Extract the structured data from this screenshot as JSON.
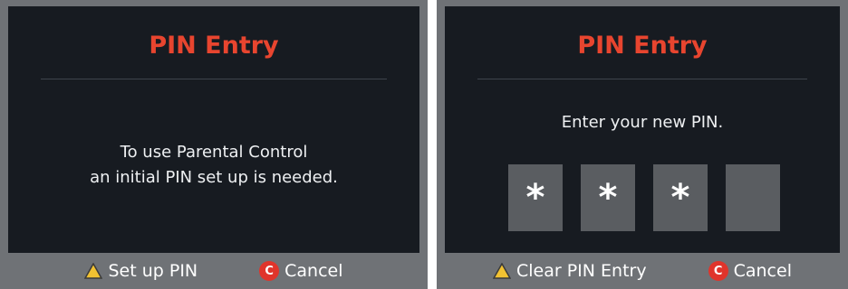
{
  "left": {
    "title": "PIN Entry",
    "message_line1": "To use Parental Control",
    "message_line2": "an initial PIN set up is needed.",
    "footer": {
      "primary_label": "Set up PIN",
      "primary_icon": "triangle-icon",
      "cancel_label": "Cancel",
      "cancel_icon_letter": "C"
    }
  },
  "right": {
    "title": "PIN Entry",
    "message": "Enter your new PIN.",
    "pin_digits": [
      "*",
      "*",
      "*",
      ""
    ],
    "footer": {
      "primary_label": "Clear PIN Entry",
      "primary_icon": "triangle-icon",
      "cancel_label": "Cancel",
      "cancel_icon_letter": "C"
    }
  },
  "colors": {
    "title": "#e8452f",
    "screen_bg": "#171b21",
    "frame": "#6f7276",
    "pin_box": "#5a5d61",
    "cancel_icon": "#e0342b",
    "triangle_icon": "#f2c232"
  }
}
